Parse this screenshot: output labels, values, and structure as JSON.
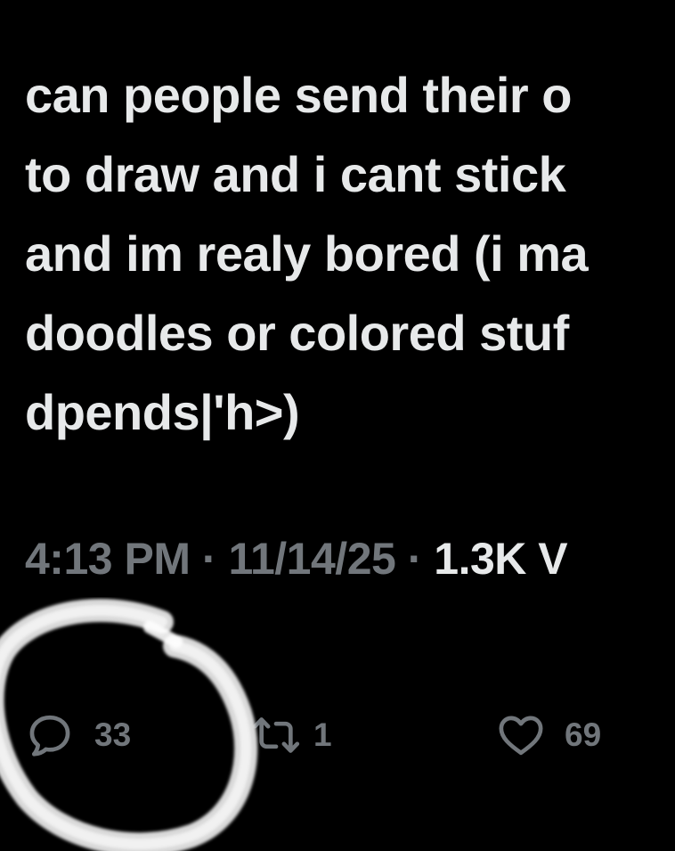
{
  "tweet": {
    "lines": [
      "can people send their o",
      "to draw and i cant stick",
      "and im realy bored (i ma",
      "doodles or colored stuf",
      "dpends|'h>)"
    ]
  },
  "meta": {
    "time": "4:13 PM",
    "separator": "·",
    "date": "11/14/25",
    "views_partial": "1.3K V"
  },
  "actions": {
    "reply": {
      "count": "33",
      "icon": "reply-icon"
    },
    "repost": {
      "count": "1",
      "icon": "repost-icon"
    },
    "like": {
      "count": "69",
      "icon": "heart-icon"
    }
  },
  "colors": {
    "background": "#000000",
    "text": "#e7e9ea",
    "muted": "#71767b"
  }
}
